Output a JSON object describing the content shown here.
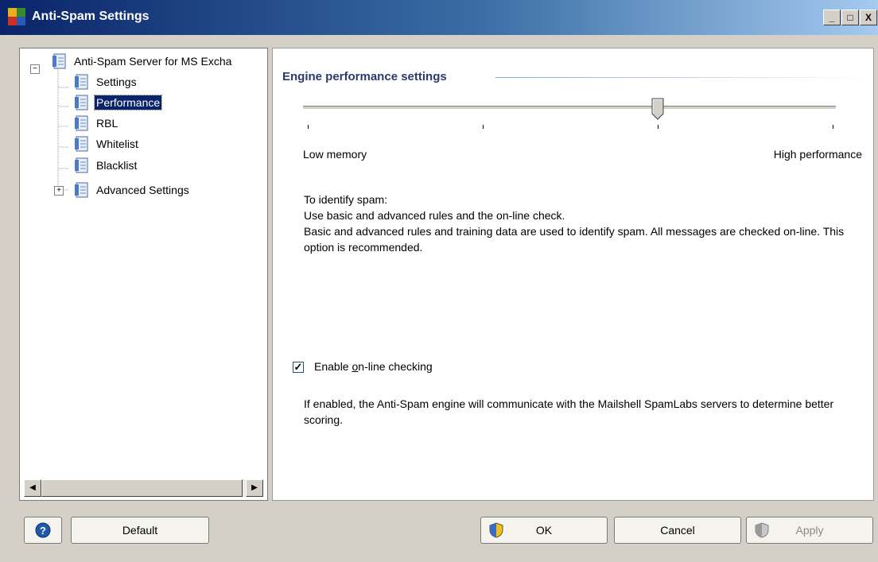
{
  "window": {
    "title": "Anti-Spam Settings",
    "controls": {
      "minimize": "_",
      "maximize": "□",
      "close": "X"
    }
  },
  "tree": {
    "root": {
      "label": "Anti-Spam Server for MS Excha",
      "expanded": true
    },
    "items": [
      {
        "label": "Settings",
        "selected": false
      },
      {
        "label": "Performance",
        "selected": true
      },
      {
        "label": "RBL",
        "selected": false
      },
      {
        "label": "Whitelist",
        "selected": false
      },
      {
        "label": "Blacklist",
        "selected": false
      },
      {
        "label": "Advanced Settings",
        "selected": false,
        "expandable": true
      }
    ]
  },
  "panel": {
    "title": "Engine performance settings",
    "slider": {
      "position": 2,
      "positions": 4,
      "low_label": "Low memory",
      "high_label": "High performance"
    },
    "description": {
      "line1": "To identify spam:",
      "line2": "Use basic and advanced rules and the on-line check.",
      "line3": "Basic and advanced rules and training data are used to identify spam. All messages are checked on-line. This option is recommended."
    },
    "online_checking": {
      "checked": true,
      "label_prefix": "Enable ",
      "label_underlined": "o",
      "label_suffix": "n-line checking",
      "help": "If enabled, the Anti-Spam engine will communicate with the Mailshell SpamLabs servers to determine better scoring."
    }
  },
  "footer": {
    "help_icon": "help-icon",
    "default_label": "Default",
    "ok_label": "OK",
    "cancel_label": "Cancel",
    "apply_label": "Apply",
    "apply_enabled": false
  },
  "colors": {
    "title_gradient_start": "#0a246a",
    "title_gradient_end": "#a6caf0",
    "selection": "#0a246a",
    "section_title": "#2b3a6b"
  }
}
